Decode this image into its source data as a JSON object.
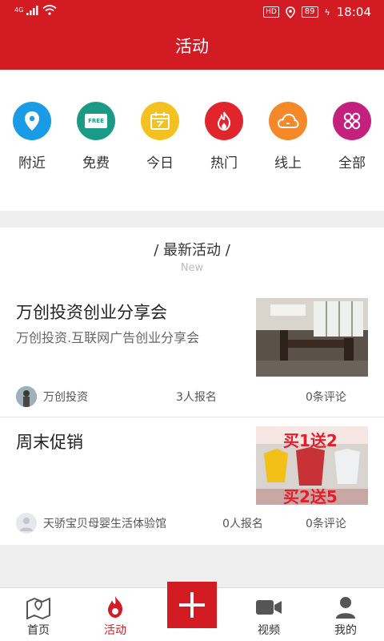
{
  "status_bar": {
    "network": "4G",
    "hd": "HD",
    "battery": "89",
    "time": "18:04"
  },
  "header": {
    "title": "活动"
  },
  "categories": [
    {
      "label": "附近",
      "icon": "location-icon",
      "color": "#1a9be6"
    },
    {
      "label": "免费",
      "icon": "free-tag-icon",
      "color": "#1b9a86"
    },
    {
      "label": "今日",
      "icon": "calendar-icon",
      "color": "#f3c221"
    },
    {
      "label": "热门",
      "icon": "flame-icon",
      "color": "#e0262c"
    },
    {
      "label": "线上",
      "icon": "cloud-icon",
      "color": "#f5892a"
    },
    {
      "label": "全部",
      "icon": "grid-icon",
      "color": "#c4217f"
    }
  ],
  "free_badge": "FREE",
  "feed": {
    "title": "/ 最新活动 /",
    "subtitle": "New",
    "items": [
      {
        "title": "万创投资创业分享会",
        "description": "万创投资.互联网广告创业分享会",
        "organizer": "万创投资",
        "signups": "3人报名",
        "comments": "0条评论"
      },
      {
        "title": "周末促销",
        "description": "",
        "organizer": "天骄宝贝母婴生活体验馆",
        "signups": "0人报名",
        "comments": "0条评论",
        "image_text_1": "买1送2",
        "image_text_2": "买2送5"
      }
    ]
  },
  "tabbar": {
    "home": "首页",
    "activity": "活动",
    "video": "视频",
    "mine": "我的"
  }
}
